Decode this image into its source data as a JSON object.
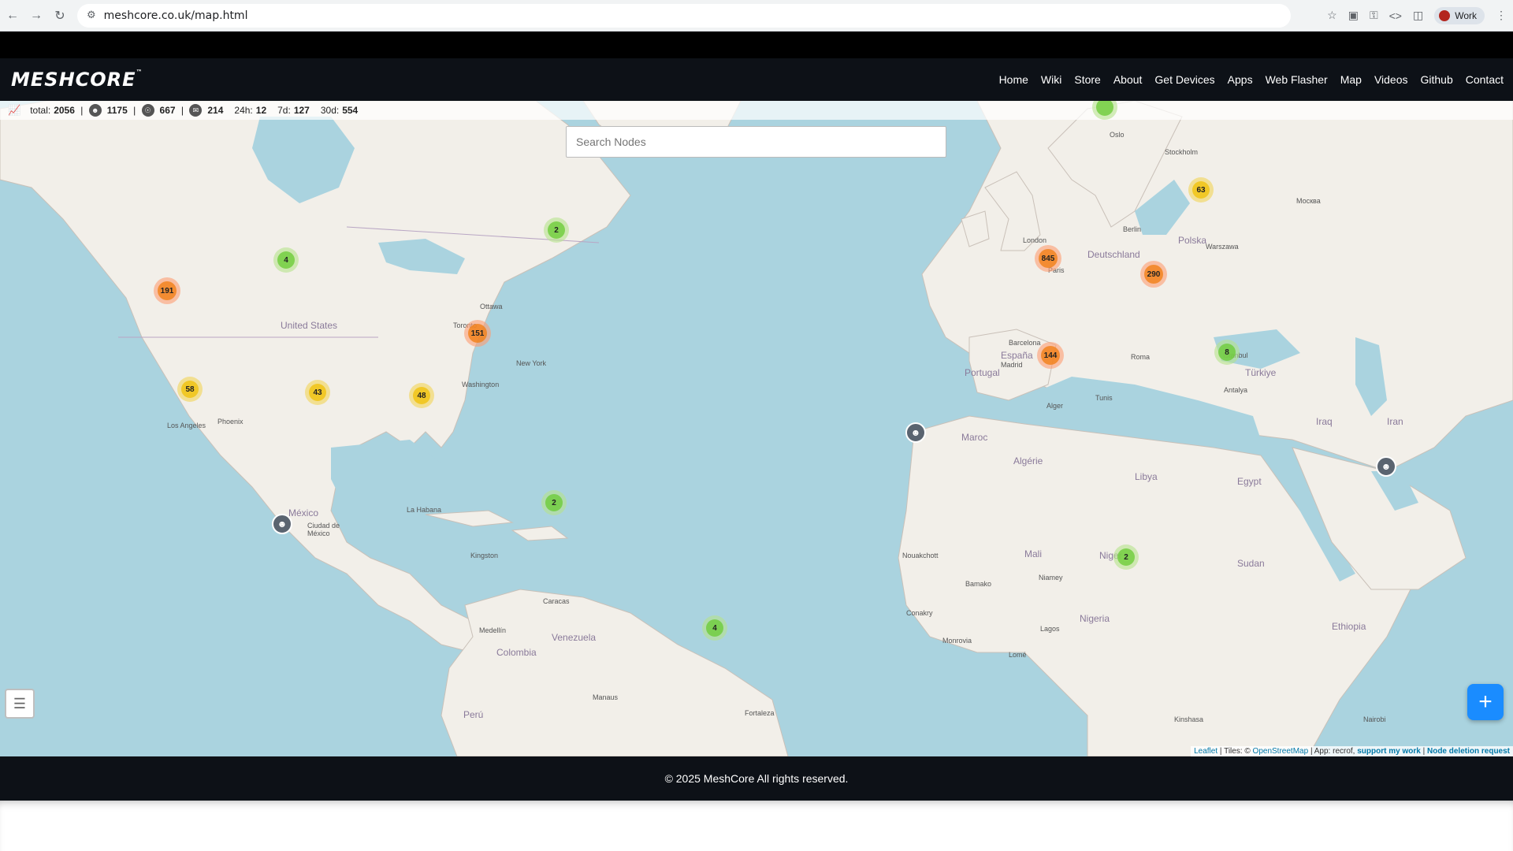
{
  "browser": {
    "url": "meshcore.co.uk/map.html",
    "profile_label": "Work"
  },
  "site": {
    "logo": "MESHCORE",
    "logo_tm": "™",
    "nav": [
      "Home",
      "Wiki",
      "Store",
      "About",
      "Get Devices",
      "Apps",
      "Web Flasher",
      "Map",
      "Videos",
      "Github",
      "Contact"
    ]
  },
  "stats": {
    "total_label": "total:",
    "total": "2056",
    "companions": "1175",
    "repeaters": "667",
    "rooms": "214",
    "h24_label": "24h:",
    "h24": "12",
    "d7_label": "7d:",
    "d7": "127",
    "d30_label": "30d:",
    "d30": "554"
  },
  "search": {
    "placeholder": "Search Nodes"
  },
  "clusters": [
    {
      "count": "191",
      "level": "orange"
    },
    {
      "count": "4",
      "level": "green"
    },
    {
      "count": "2",
      "level": "green"
    },
    {
      "count": "151",
      "level": "orange"
    },
    {
      "count": "58",
      "level": "yellow"
    },
    {
      "count": "43",
      "level": "yellow"
    },
    {
      "count": "48",
      "level": "yellow"
    },
    {
      "count": "2",
      "level": "green"
    },
    {
      "count": "4",
      "level": "green"
    },
    {
      "count": "845",
      "level": "orange"
    },
    {
      "count": "290",
      "level": "orange"
    },
    {
      "count": "63",
      "level": "yellow"
    },
    {
      "count": "144",
      "level": "orange"
    },
    {
      "count": "8",
      "level": "green"
    },
    {
      "count": "2",
      "level": "green"
    }
  ],
  "map_labels": {
    "cities": [
      "Ottawa",
      "Toronto",
      "New York",
      "Washington",
      "Los Angeles",
      "Phoenix",
      "Ciudad de México",
      "La Habana",
      "Kingston",
      "Caracas",
      "Medellín",
      "Manaus",
      "Fortaleza",
      "Paris",
      "London",
      "Madrid",
      "Barcelona",
      "Roma",
      "Berlin",
      "Warszawa",
      "Oslo",
      "Stockholm",
      "Москва",
      "Istanbul",
      "Antalya",
      "Alger",
      "Tunis",
      "Bamako",
      "Niamey",
      "Lagos",
      "Kinshasa",
      "Nairobi",
      "Conakry",
      "Nouakchott",
      "Lomé",
      "Monrovia"
    ],
    "countries": [
      "United States",
      "México",
      "Algérie",
      "Mali",
      "Niger",
      "Nigeria",
      "Venezuela",
      "Colombia",
      "Perú",
      "Polska",
      "Deutschland",
      "España",
      "Portugal",
      "Maroc",
      "Libya",
      "Egypt",
      "Sudan",
      "Ethiopia",
      "Türkiye",
      "Iraq",
      "Iran"
    ]
  },
  "attribution": {
    "leaflet": "Leaflet",
    "tiles_prefix": "| Tiles: ©",
    "osm": "OpenStreetMap",
    "app": "| App: recrof,",
    "support": "support my work",
    "sep": "|",
    "deletion": "Node deletion request"
  },
  "footer": {
    "text": "© 2025 MeshCore All rights reserved."
  },
  "colors": {
    "sea": "#aad3df",
    "land": "#f2efe9",
    "header_bg": "#0d1117",
    "add_button": "#1a8cff"
  }
}
